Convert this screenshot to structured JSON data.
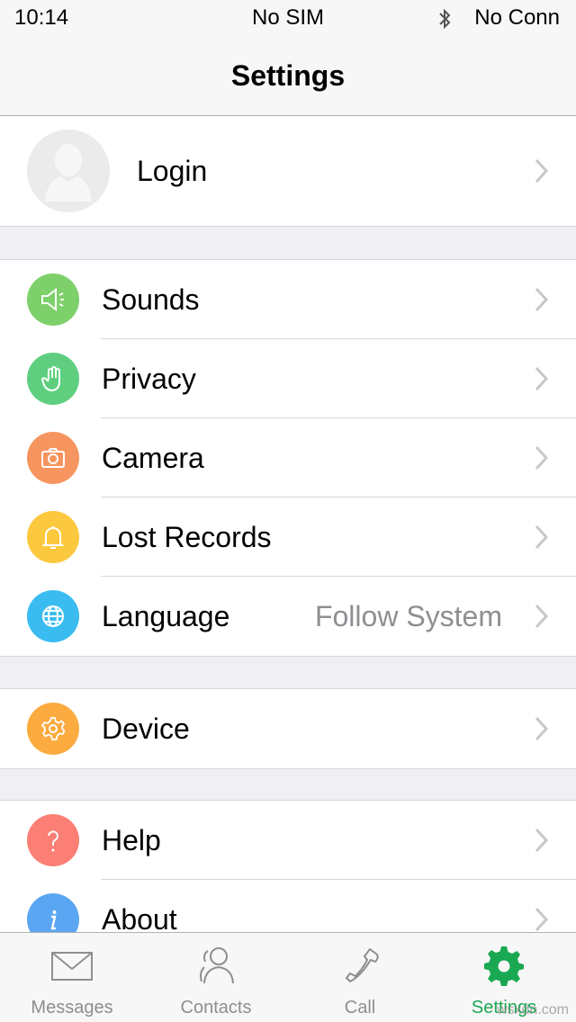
{
  "status_bar": {
    "time": "10:14",
    "carrier": "No SIM",
    "connection": "No Conn",
    "bluetooth_icon": "bluetooth-icon"
  },
  "nav": {
    "title": "Settings"
  },
  "login": {
    "label": "Login",
    "icon": "avatar-placeholder-icon"
  },
  "group1": [
    {
      "label": "Sounds",
      "icon": "speaker-icon",
      "color": "#7ed06a",
      "value": ""
    },
    {
      "label": "Privacy",
      "icon": "hand-icon",
      "color": "#5fcf7f",
      "value": ""
    },
    {
      "label": "Camera",
      "icon": "camera-icon",
      "color": "#f6955f",
      "value": ""
    },
    {
      "label": "Lost Records",
      "icon": "bell-icon",
      "color": "#fcc83d",
      "value": ""
    },
    {
      "label": "Language",
      "icon": "globe-icon",
      "color": "#3bbcf1",
      "value": "Follow System"
    }
  ],
  "group2": [
    {
      "label": "Device",
      "icon": "gear-icon",
      "color": "#fbab3f",
      "value": ""
    }
  ],
  "group3": [
    {
      "label": "Help",
      "icon": "question-icon",
      "color": "#fb7f74",
      "value": ""
    },
    {
      "label": "About",
      "icon": "info-icon",
      "color": "#5aa6f3",
      "value": ""
    }
  ],
  "tabs": [
    {
      "label": "Messages",
      "icon": "envelope-icon",
      "active": false
    },
    {
      "label": "Contacts",
      "icon": "contacts-icon",
      "active": false
    },
    {
      "label": "Call",
      "icon": "phone-icon",
      "active": false
    },
    {
      "label": "Settings",
      "icon": "gear-icon",
      "active": true
    }
  ],
  "colors": {
    "accent": "#1ba853",
    "chevron": "#c7c7cc",
    "secondary_text": "#8e8e93"
  },
  "watermark": "wsxdn.com"
}
